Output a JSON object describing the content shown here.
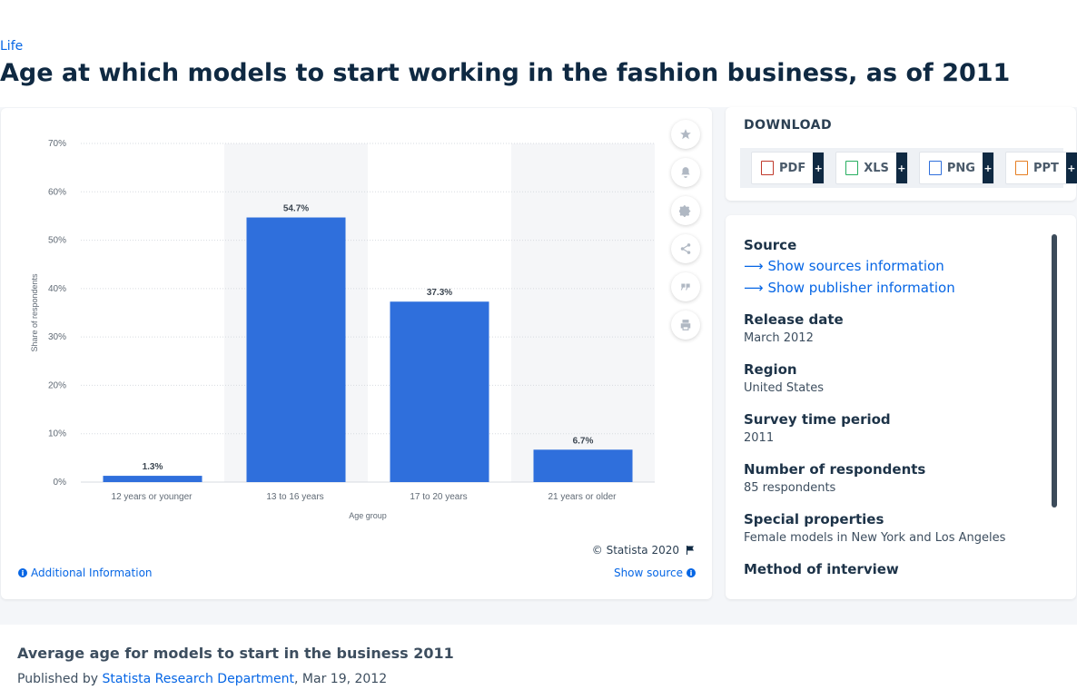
{
  "breadcrumb": "Life",
  "title": "Age at which models to start working in the fashion business, as of 2011",
  "chart_data": {
    "type": "bar",
    "categories": [
      "12 years or younger",
      "13 to 16 years",
      "17 to 20 years",
      "21 years or older"
    ],
    "values": [
      1.3,
      54.7,
      37.3,
      6.7
    ],
    "value_labels": [
      "1.3%",
      "54.7%",
      "37.3%",
      "6.7%"
    ],
    "xlabel": "Age group",
    "ylabel": "Share of respondents",
    "ylim": [
      0,
      70
    ],
    "yticks": [
      "0%",
      "10%",
      "20%",
      "30%",
      "40%",
      "50%",
      "60%",
      "70%"
    ],
    "bar_color": "#2f6fdc",
    "grid": true,
    "highlight_band_color": "#f5f6f8"
  },
  "chart_footer": {
    "copyright": "© Statista 2020",
    "additional_info": "Additional Information",
    "show_source": "Show source"
  },
  "download": {
    "title": "DOWNLOAD",
    "buttons": [
      {
        "label": "PDF",
        "plus": "+"
      },
      {
        "label": "XLS",
        "plus": "+"
      },
      {
        "label": "PNG",
        "plus": "+"
      },
      {
        "label": "PPT",
        "plus": "+"
      }
    ]
  },
  "info": {
    "source_label": "Source",
    "show_sources": "Show sources information",
    "show_publisher": "Show publisher information",
    "release_date_label": "Release date",
    "release_date": "March 2012",
    "region_label": "Region",
    "region": "United States",
    "survey_period_label": "Survey time period",
    "survey_period": "2011",
    "respondents_label": "Number of respondents",
    "respondents": "85 respondents",
    "special_label": "Special properties",
    "special": "Female models in New York and Los Angeles",
    "method_label": "Method of interview"
  },
  "related": {
    "title": "Average age for models to start in the business 2011",
    "published_by": "Published by",
    "publisher": "Statista Research Department",
    "date": ", Mar 19, 2012"
  },
  "colors": {
    "accent": "#0666e5",
    "dark": "#0f2942"
  }
}
